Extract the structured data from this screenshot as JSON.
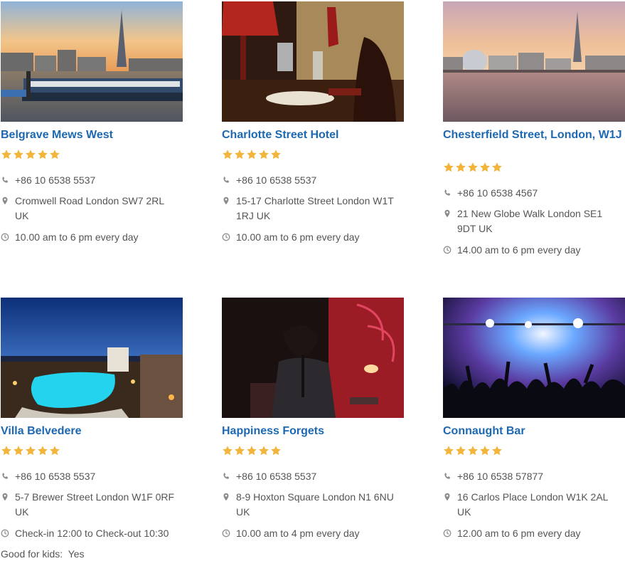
{
  "colors": {
    "title": "#1d68b3",
    "star": "#f2b43b",
    "text": "#555555",
    "icon": "#8a8a8a"
  },
  "icons": {
    "rating": "star-icon",
    "phone": "phone-icon",
    "address": "map-marker-icon",
    "hours": "clock-icon"
  },
  "listings": [
    {
      "name": "Belgrave Mews West",
      "rating": 5,
      "phone": "+86 10 6538 5537",
      "address": "Cromwell Road London SW7 2RL UK",
      "hours": "10.00 am to 6 pm every day",
      "image": "london-skyline-shard-river-boat-photo"
    },
    {
      "name": "Charlotte Street Hotel",
      "rating": 5,
      "phone": "+86 10 6538 5537",
      "address": "15-17 Charlotte Street London W1T 1RJ UK",
      "hours": "10.00 am to 6 pm every day",
      "image": "restaurant-table-lamp-photo"
    },
    {
      "name": "Chesterfield Street, London, W1J",
      "rating": 5,
      "phone": "+86 10 6538 4567",
      "address": "21 New Globe Walk London SE1 9DT UK",
      "hours": "14.00 am to 6 pm every day",
      "image": "london-city-hall-river-sunset-photo"
    },
    {
      "name": "Villa Belvedere",
      "rating": 5,
      "phone": "+86 10 6538 5537",
      "address": "5-7 Brewer Street London W1F 0RF UK",
      "hours": "Check-in 12:00 to Check-out 10:30",
      "image": "villa-pool-night-photo",
      "extra_label": "Good for kids:",
      "extra_value": "Yes"
    },
    {
      "name": "Happiness Forgets",
      "rating": 5,
      "phone": "+86 10 6538 5537",
      "address": "8-9 Hoxton Square London N1 6NU UK",
      "hours": "10.00 am to 4 pm every day",
      "image": "singer-on-stage-photo"
    },
    {
      "name": "Connaught Bar",
      "rating": 5,
      "phone": "+86 10 6538 57877",
      "address": "16 Carlos Place London W1K 2AL UK",
      "hours": "12.00 am to 6 pm every day",
      "image": "concert-crowd-lights-photo"
    }
  ]
}
